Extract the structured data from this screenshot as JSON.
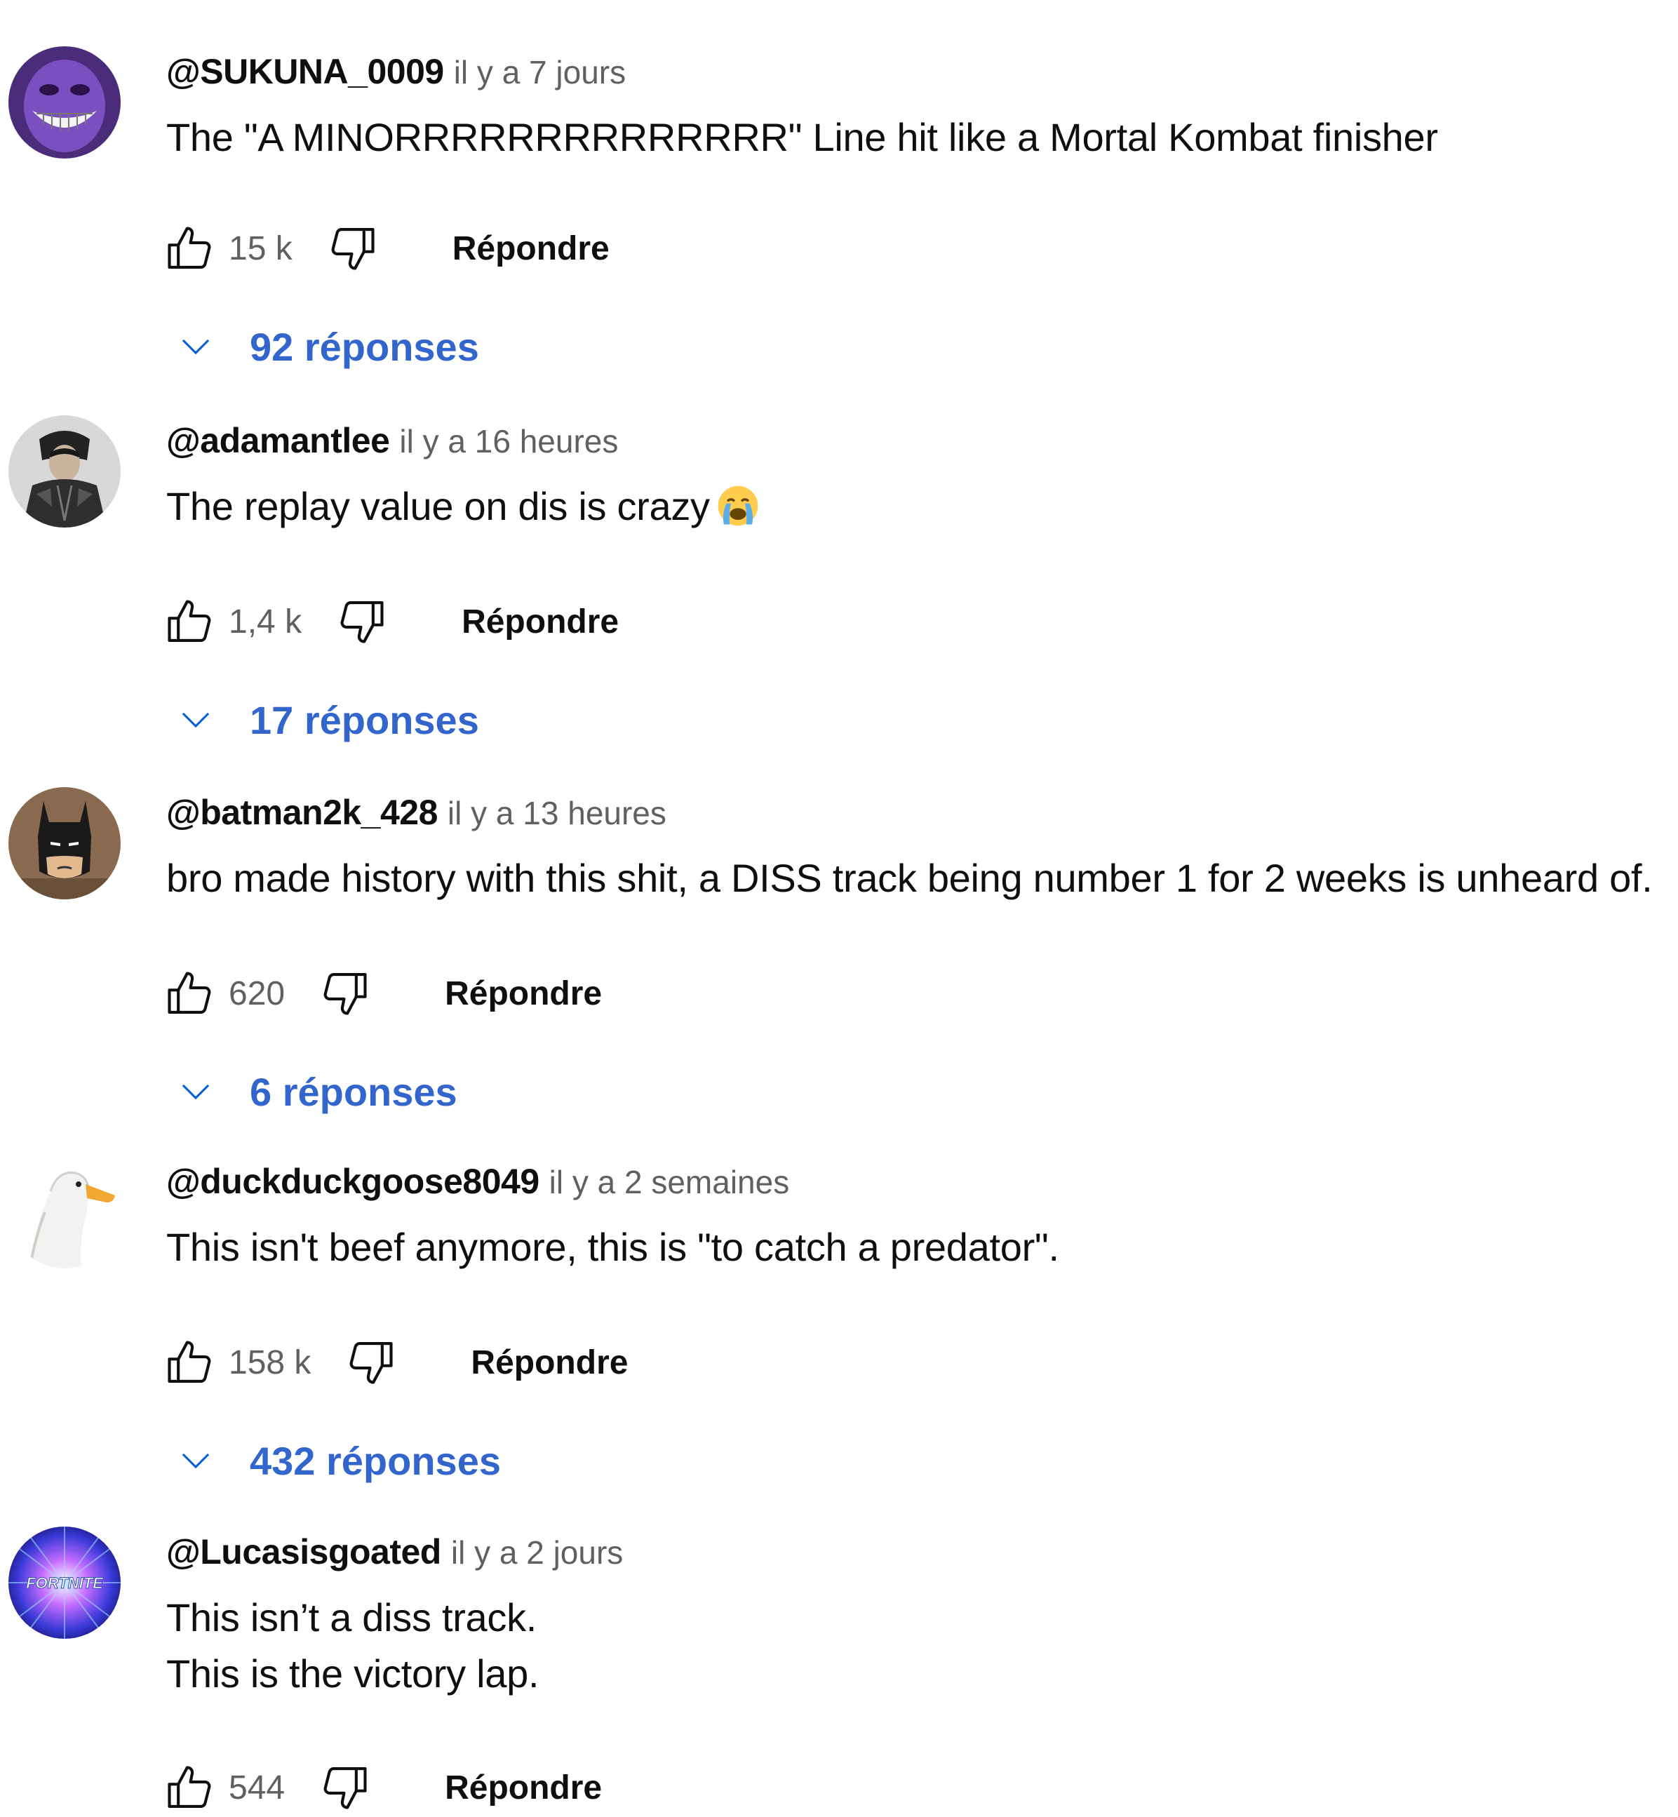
{
  "comments": [
    {
      "author": "@SUKUNA_0009",
      "time": "il y a 7 jours",
      "text": "The \"A MINORRRRRRRRRRRRRR\" Line hit like a Mortal Kombat finisher",
      "likes": "15 k",
      "reply_label": "Répondre",
      "replies_label": "92 réponses"
    },
    {
      "author": "@adamantlee",
      "time": "il y a 16 heures",
      "text": "The replay value on dis is crazy",
      "emoji": "loudly-crying-face",
      "likes": "1,4 k",
      "reply_label": "Répondre",
      "replies_label": "17 réponses"
    },
    {
      "author": "@batman2k_428",
      "time": "il y a 13 heures",
      "text": "bro made history with this shit, a DISS track being number 1 for 2 weeks is unheard of.",
      "likes": "620",
      "reply_label": "Répondre",
      "replies_label": "6 réponses"
    },
    {
      "author": "@duckduckgoose8049",
      "time": "il y a 2 semaines",
      "text": "This isn't beef anymore, this is \"to catch a predator\".",
      "likes": "158 k",
      "reply_label": "Répondre",
      "replies_label": "432 réponses"
    },
    {
      "author": "@Lucasisgoated",
      "time": "il y a 2 jours",
      "text": "This isn’t a diss track.\nThis is the victory lap.",
      "likes": "544",
      "reply_label": "Répondre"
    }
  ],
  "avatar_logo_text": "FORTNITE",
  "colors": {
    "text": "#0f0f0f",
    "secondary": "#606060",
    "link": "#3366cc"
  }
}
